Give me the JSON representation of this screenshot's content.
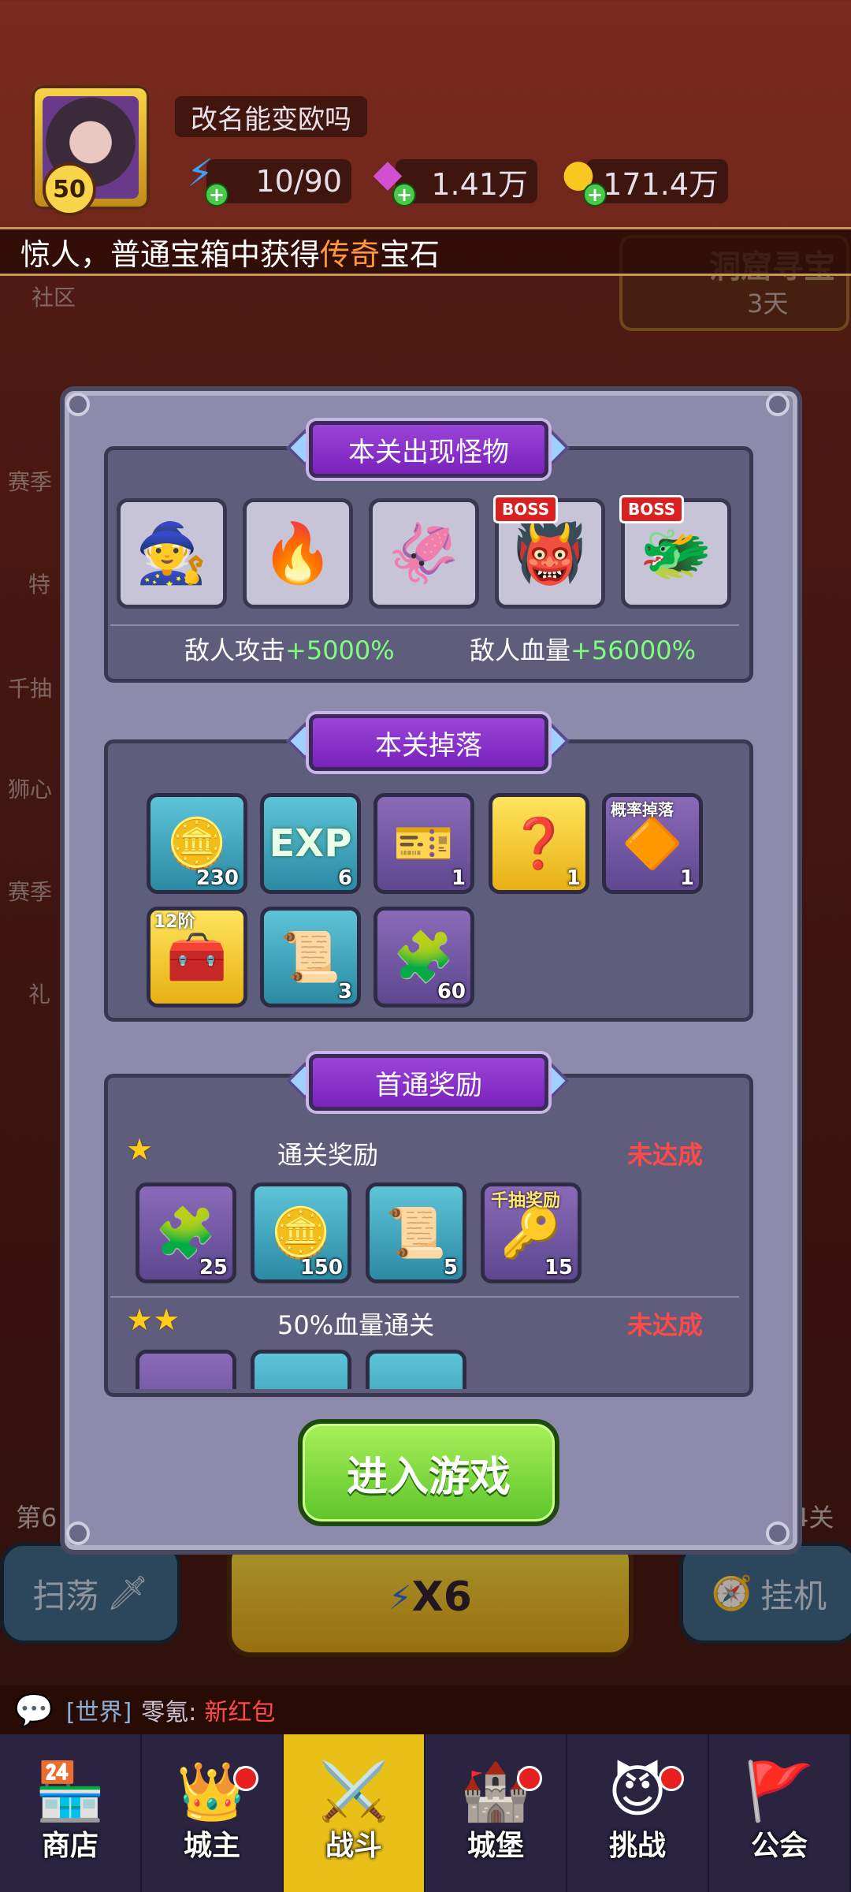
{
  "player": {
    "level": "50",
    "name": "改名能变欧吗"
  },
  "resources": {
    "energy": "10/90",
    "gems": "1.41万",
    "coins": "171.4万"
  },
  "ticker": {
    "prefix": "惊人，普通宝箱中获得",
    "highlight": "传奇",
    "suffix": "宝石"
  },
  "background": {
    "community": "社区",
    "cave_event": "洞窟寻宝",
    "cave_days": "3天",
    "left_labels": [
      "赛季",
      "特",
      "千抽",
      "狮心",
      "赛季",
      "礼"
    ],
    "stage_left": "第6",
    "stage_right": "4关",
    "sweep": "扫荡",
    "battle_mult": "X6",
    "idle": "挂机"
  },
  "monsters_section": {
    "title": "本关出现怪物",
    "monsters": [
      {
        "icon": "🧙",
        "boss": ""
      },
      {
        "icon": "🔥",
        "boss": ""
      },
      {
        "icon": "🦑",
        "boss": ""
      },
      {
        "icon": "👹",
        "boss": "BOSS"
      },
      {
        "icon": "🐲",
        "boss": "BOSS"
      }
    ],
    "attack_label": "敌人攻击",
    "attack_value": "+5000%",
    "hp_label": "敌人血量",
    "hp_value": "+56000%"
  },
  "drops_section": {
    "title": "本关掉落",
    "row1": [
      {
        "icon": "🪙",
        "count": "230",
        "tag": ""
      },
      {
        "icon": "EXP",
        "count": "6",
        "tag": ""
      },
      {
        "icon": "🎫",
        "count": "1",
        "tag": ""
      },
      {
        "icon": "❓",
        "count": "1",
        "tag": ""
      },
      {
        "icon": "🔶",
        "count": "1",
        "tag": "概率掉落"
      }
    ],
    "row2": [
      {
        "icon": "🧰",
        "count": "",
        "tag": "12阶"
      },
      {
        "icon": "📜",
        "count": "3",
        "tag": ""
      },
      {
        "icon": "🧩",
        "count": "60",
        "tag": ""
      }
    ]
  },
  "first_clear_section": {
    "title": "首通奖励",
    "reward1": {
      "title": "通关奖励",
      "status": "未达成",
      "items": [
        {
          "icon": "🧩",
          "count": "25",
          "tag": ""
        },
        {
          "icon": "🪙",
          "count": "150",
          "tag": ""
        },
        {
          "icon": "📜",
          "count": "5",
          "tag": ""
        },
        {
          "icon": "🔑",
          "count": "15",
          "tag": "千抽奖励"
        }
      ]
    },
    "reward2": {
      "title": "50%血量通关",
      "status": "未达成"
    }
  },
  "enter_button": "进入游戏",
  "chat": {
    "channel": "[世界]",
    "user": "零氪:",
    "message": "新红包"
  },
  "nav": [
    {
      "label": "商店",
      "icon": "🏪",
      "badge": false,
      "active": false
    },
    {
      "label": "城主",
      "icon": "👑",
      "badge": true,
      "active": false
    },
    {
      "label": "战斗",
      "icon": "⚔️",
      "badge": false,
      "active": true
    },
    {
      "label": "城堡",
      "icon": "🏰",
      "badge": true,
      "active": false
    },
    {
      "label": "挑战",
      "icon": "😈",
      "badge": true,
      "active": false
    },
    {
      "label": "公会",
      "icon": "🚩",
      "badge": false,
      "active": false
    }
  ]
}
